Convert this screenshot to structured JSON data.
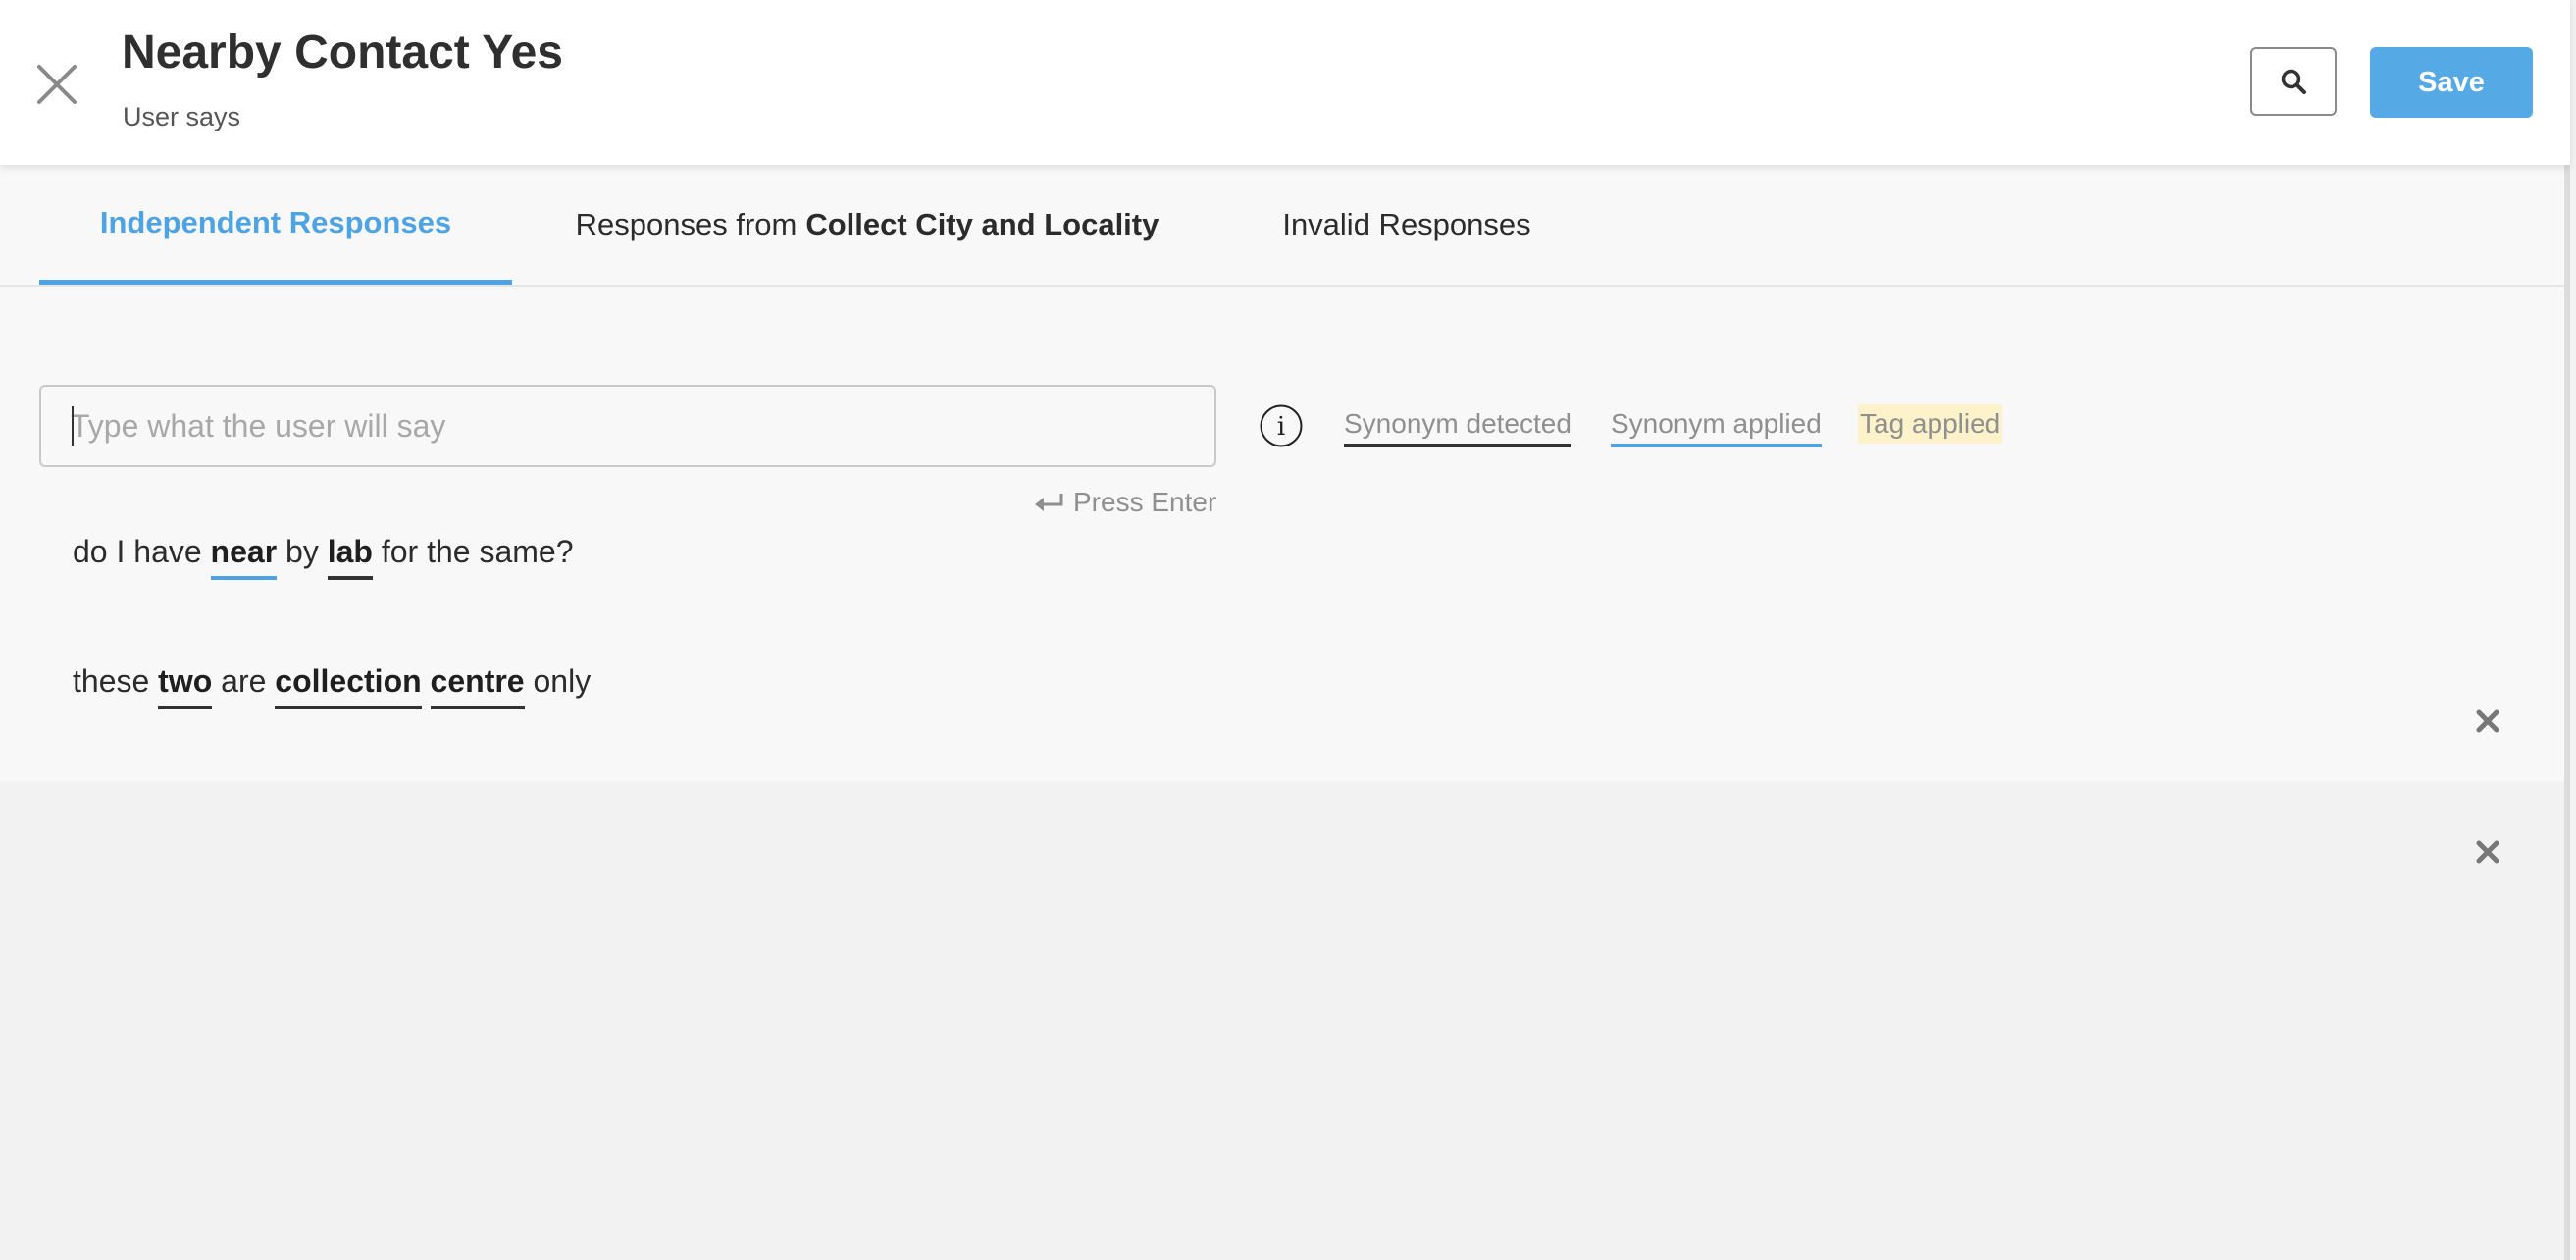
{
  "header": {
    "title": "Nearby Contact Yes",
    "subtitle": "User says",
    "save_label": "Save"
  },
  "tabs": [
    {
      "label": "Independent Responses",
      "bold": "",
      "active": true
    },
    {
      "label": "Responses from",
      "bold": "Collect City and Locality",
      "active": false
    },
    {
      "label": "Invalid Responses",
      "bold": "",
      "active": false
    }
  ],
  "input": {
    "placeholder": "Type what the user will say",
    "value": "",
    "hint": "Press Enter"
  },
  "legend": {
    "synonym_detected": "Synonym detected",
    "synonym_applied": "Synonym applied",
    "tag_applied": "Tag applied"
  },
  "utterances": [
    {
      "segments": [
        {
          "text": "do I have ",
          "style": "plain"
        },
        {
          "text": "near",
          "style": "synonym-applied"
        },
        {
          "text": " by ",
          "style": "plain"
        },
        {
          "text": "lab",
          "style": "synonym-detected"
        },
        {
          "text": " for the same?",
          "style": "plain"
        }
      ]
    },
    {
      "segments": [
        {
          "text": "these ",
          "style": "plain"
        },
        {
          "text": "two",
          "style": "synonym-detected"
        },
        {
          "text": " are ",
          "style": "plain"
        },
        {
          "text": "collection",
          "style": "synonym-detected"
        },
        {
          "text": " ",
          "style": "plain"
        },
        {
          "text": "centre",
          "style": "synonym-detected"
        },
        {
          "text": " only",
          "style": "plain"
        }
      ]
    }
  ],
  "icons": {
    "close": "close-icon",
    "search": "search-icon",
    "info": "info-icon",
    "enter": "enter-icon",
    "remove": "remove-icon"
  },
  "colors": {
    "accent": "#4da3e4",
    "save_button": "#55aae6",
    "synonym_detected_underline": "#333333",
    "synonym_applied_underline": "#4da3e4",
    "tag_highlight": "#fdf2c9"
  }
}
